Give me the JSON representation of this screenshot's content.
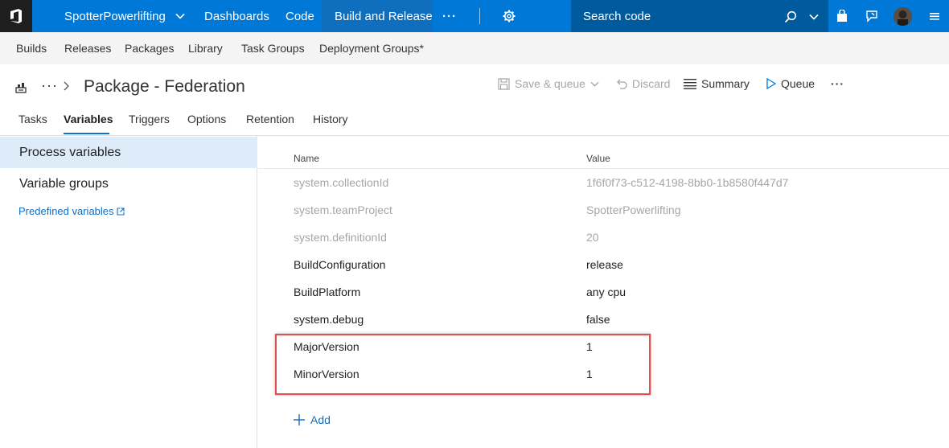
{
  "topbar": {
    "project": "SpotterPowerlifting",
    "hubs": [
      "Dashboards",
      "Code",
      "Build and Release"
    ],
    "more": "···",
    "search_placeholder": "Search code"
  },
  "subnav": {
    "items": [
      "Builds",
      "Releases",
      "Packages",
      "Library",
      "Task Groups",
      "Deployment Groups*"
    ]
  },
  "title_row": {
    "breadcrumb_more": "···",
    "title": "Package - Federation",
    "save_queue": "Save & queue",
    "discard": "Discard",
    "summary": "Summary",
    "queue": "Queue",
    "more": "···"
  },
  "tabs": [
    "Tasks",
    "Variables",
    "Triggers",
    "Options",
    "Retention",
    "History"
  ],
  "left_panel": {
    "process_variables": "Process variables",
    "variable_groups": "Variable groups",
    "predefined_variables": "Predefined variables"
  },
  "grid": {
    "col_name": "Name",
    "col_value": "Value",
    "rows": [
      {
        "name": "system.collectionId",
        "value": "1f6f0f73-c512-4198-8bb0-1b8580f447d7",
        "system": true
      },
      {
        "name": "system.teamProject",
        "value": "SpotterPowerlifting",
        "system": true
      },
      {
        "name": "system.definitionId",
        "value": "20",
        "system": true
      },
      {
        "name": "BuildConfiguration",
        "value": "release",
        "system": false
      },
      {
        "name": "BuildPlatform",
        "value": "any cpu",
        "system": false
      },
      {
        "name": "system.debug",
        "value": "false",
        "system": false
      },
      {
        "name": "MajorVersion",
        "value": "1",
        "system": false
      },
      {
        "name": "MinorVersion",
        "value": "1",
        "system": false
      }
    ],
    "add_label": "Add"
  },
  "colors": {
    "brand_blue": "#0078d7",
    "selected_bg": "#deecf9",
    "highlight": "#e05050"
  }
}
